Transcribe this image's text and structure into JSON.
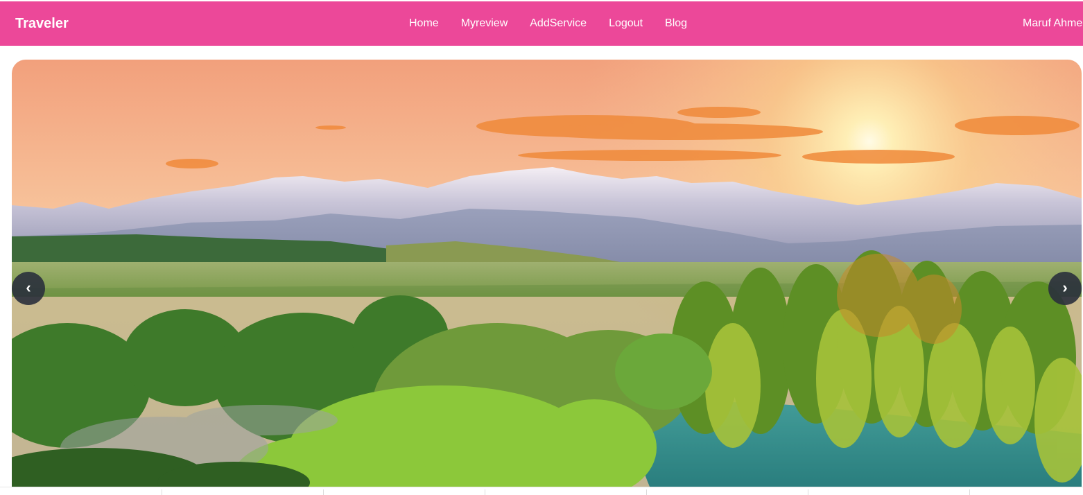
{
  "navbar": {
    "brand": "Traveler",
    "links": [
      {
        "label": "Home"
      },
      {
        "label": "Myreview"
      },
      {
        "label": "AddService"
      },
      {
        "label": "Logout"
      },
      {
        "label": "Blog"
      }
    ],
    "user_name": "Maruf Ahme",
    "background_color": "#ec4899"
  },
  "carousel": {
    "prev_label": "‹",
    "next_label": "›",
    "image_description_icon": "landscape-photo"
  }
}
